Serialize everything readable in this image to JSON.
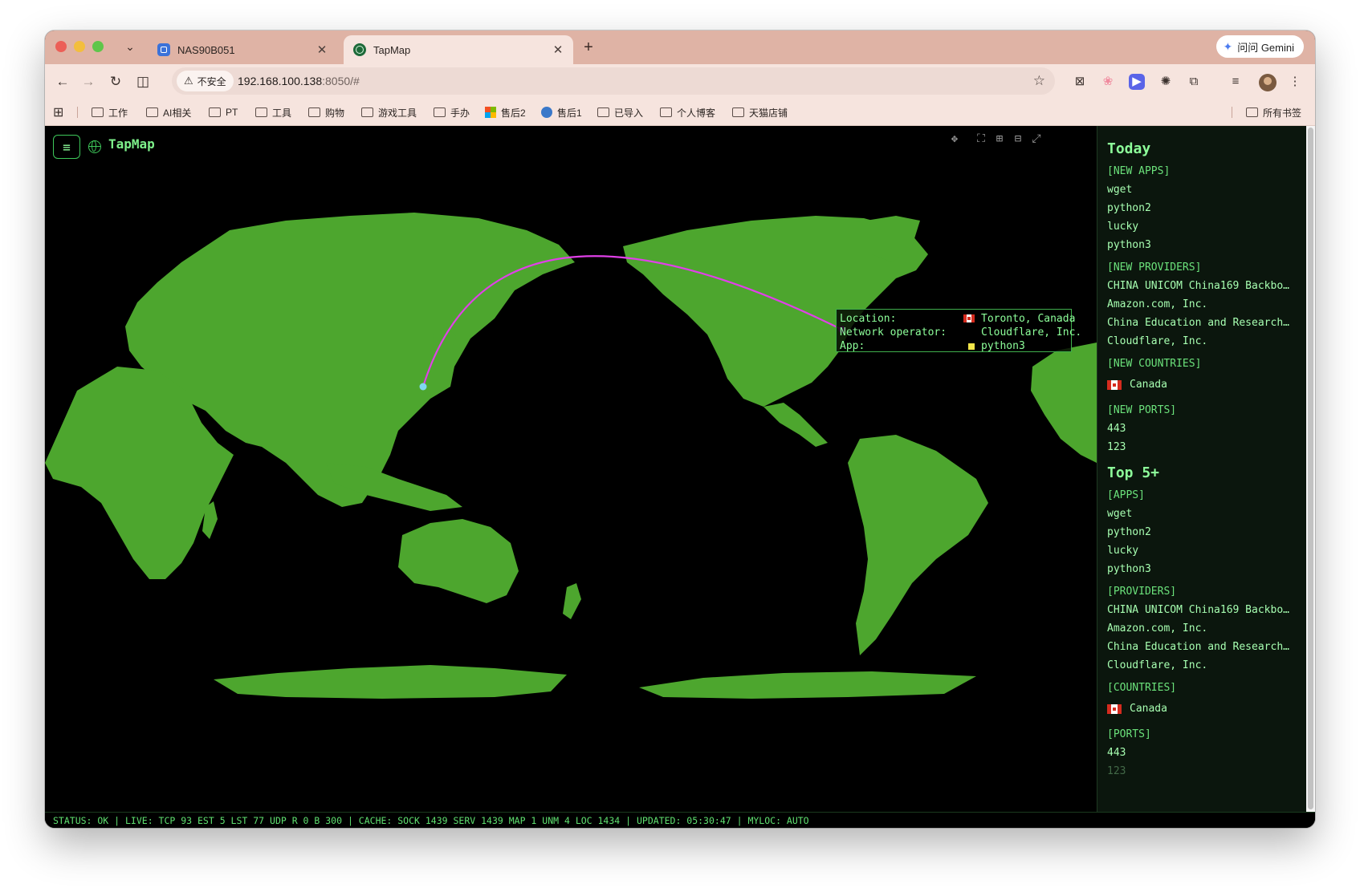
{
  "browser": {
    "tabs": [
      {
        "title": "NAS90B051",
        "favicon": "nas-icon"
      },
      {
        "title": "TapMap",
        "favicon": "globe-icon",
        "active": true
      }
    ],
    "gemini_label": "问问 Gemini",
    "security_label": "不安全",
    "url_host": "192.168.100.138",
    "url_rest": ":8050/#",
    "bookmarks": [
      "工作",
      "AI相关",
      "PT",
      "工具",
      "购物",
      "游戏工具",
      "手办",
      "售后2",
      "售后1",
      "已导入",
      "个人博客",
      "天猫店铺"
    ],
    "all_bookmarks": "所有书签"
  },
  "app": {
    "title": "TapMap",
    "map": {
      "land_color": "#4da62e",
      "arc_color": "#e040e8",
      "origin_color": "#7fd8f0",
      "tooltip": {
        "location_label": "Location:",
        "location_value": "Toronto, Canada",
        "operator_label": "Network operator:",
        "operator_value": "Cloudflare, Inc.",
        "app_label": "App:",
        "app_value": "python3"
      }
    },
    "sidebar": {
      "today_heading": "Today",
      "new_apps_heading": "[NEW APPS]",
      "new_apps": [
        "wget",
        "python2",
        "lucky",
        "python3"
      ],
      "new_providers_heading": "[NEW PROVIDERS]",
      "new_providers": [
        "CHINA UNICOM China169 Backbo…",
        "Amazon.com, Inc.",
        "China Education and Research…",
        "Cloudflare, Inc."
      ],
      "new_countries_heading": "[NEW COUNTRIES]",
      "new_countries": [
        "Canada"
      ],
      "new_ports_heading": "[NEW PORTS]",
      "new_ports": [
        "443",
        "123"
      ],
      "top_heading": "Top 5+",
      "apps_heading": "[APPS]",
      "apps": [
        "wget",
        "python2",
        "lucky",
        "python3"
      ],
      "providers_heading": "[PROVIDERS]",
      "providers": [
        "CHINA UNICOM China169 Backbo…",
        "Amazon.com, Inc.",
        "China Education and Research…",
        "Cloudflare, Inc."
      ],
      "countries_heading": "[COUNTRIES]",
      "countries": [
        "Canada"
      ],
      "ports_heading": "[PORTS]",
      "ports": [
        "443",
        "123"
      ]
    },
    "status_bar": "STATUS: OK | LIVE: TCP 93 EST 5 LST 77 UDP R 0 B 300 | CACHE: SOCK 1439 SERV 1439 MAP 1 UNM 4 LOC 1434 | UPDATED: 05:30:47 | MYLOC: AUTO"
  }
}
